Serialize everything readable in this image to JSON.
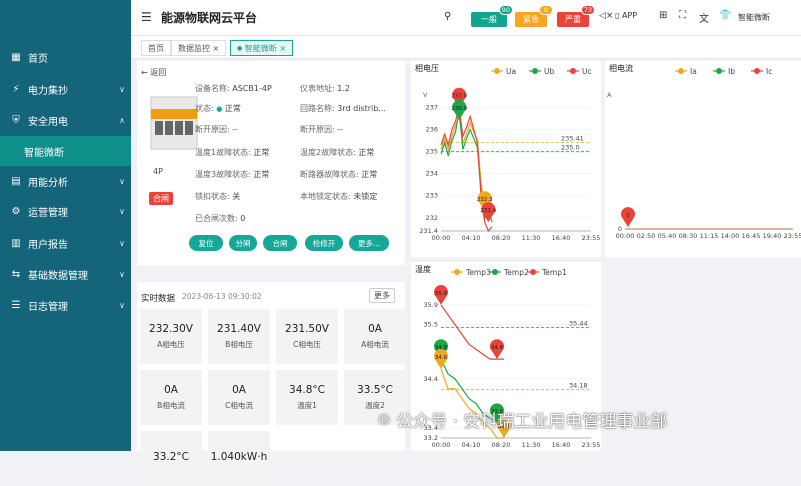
{
  "app": {
    "title": "能源物联网云平台"
  },
  "sidebar": {
    "items": [
      {
        "icon": "▦",
        "label": "首页",
        "chev": ""
      },
      {
        "icon": "⚡",
        "label": "电力集抄",
        "chev": "∨"
      },
      {
        "icon": "⛨",
        "label": "安全用电",
        "chev": "∧"
      },
      {
        "icon": "",
        "label": "智能微断",
        "chev": ""
      },
      {
        "icon": "▤",
        "label": "用能分析",
        "chev": "∨"
      },
      {
        "icon": "⚙",
        "label": "运营管理",
        "chev": "∨"
      },
      {
        "icon": "▥",
        "label": "用户报告",
        "chev": "∨"
      },
      {
        "icon": "⇆",
        "label": "基础数据管理",
        "chev": "∨"
      },
      {
        "icon": "☰",
        "label": "日志管理",
        "chev": "∨"
      }
    ]
  },
  "header": {
    "alarms": [
      {
        "label": "一般",
        "count": "90",
        "color": "#12a58e"
      },
      {
        "label": "紧急",
        "count": "0",
        "color": "#f5a623"
      },
      {
        "label": "严重",
        "count": "73",
        "color": "#e9433a"
      }
    ],
    "app_label": "APP",
    "user": "智能微断",
    "icons": [
      "search-icon",
      "mute-icon",
      "qrcode-icon",
      "fullscreen-icon",
      "language-icon",
      "skin-icon"
    ]
  },
  "tabs": [
    {
      "label": "首页"
    },
    {
      "label": "数据监控",
      "close": "×"
    },
    {
      "label": "智能微断",
      "close": "×"
    }
  ],
  "device": {
    "back": "← 返回",
    "poles": "4P",
    "status_tag": "合闸",
    "fields": [
      {
        "k": "设备名称:",
        "v": "ASCB1-4P"
      },
      {
        "k": "仪表地址:",
        "v": "1.2"
      },
      {
        "k": "状态:",
        "v": "正常"
      },
      {
        "k": "回路名称:",
        "v": "3rd distrib..."
      },
      {
        "k": "断开原因:",
        "v": "--"
      },
      {
        "k": "断开原因:",
        "v": "--"
      },
      {
        "k": "温度1故障状态:",
        "v": "正常"
      },
      {
        "k": "温度2故障状态:",
        "v": "正常"
      },
      {
        "k": "温度3故障状态:",
        "v": "正常"
      },
      {
        "k": "断路器故障状态:",
        "v": "正常"
      },
      {
        "k": "锁扣状态:",
        "v": "关"
      },
      {
        "k": "本地锁定状态:",
        "v": "未锁定"
      },
      {
        "k": "已合闸次数:",
        "v": "0"
      }
    ],
    "buttons": [
      "复位",
      "分闸",
      "合闸",
      "检修开",
      "更多..."
    ]
  },
  "realtime": {
    "title": "实时数据",
    "time": "2023-06-13 09:30:02",
    "more": "更多",
    "tiles": [
      {
        "v": "232.30V",
        "n": "A相电压"
      },
      {
        "v": "231.40V",
        "n": "B相电压"
      },
      {
        "v": "231.50V",
        "n": "C相电压"
      },
      {
        "v": "0A",
        "n": "A相电流"
      },
      {
        "v": "0A",
        "n": "B相电流"
      },
      {
        "v": "0A",
        "n": "C相电流"
      },
      {
        "v": "34.8°C",
        "n": "温度1"
      },
      {
        "v": "33.5°C",
        "n": "温度2"
      },
      {
        "v": "33.2°C",
        "n": ""
      },
      {
        "v": "1.040kW·h",
        "n": ""
      }
    ]
  },
  "watermark": "公众号 · 安科瑞工业用电管理事业部",
  "chart_data": [
    {
      "type": "line",
      "title": "相电压",
      "ylabel": "V",
      "xticks": [
        "00:00",
        "04:10",
        "08:20",
        "11:30",
        "16:40",
        "23:55"
      ],
      "yticks": [
        "231.4",
        "232",
        "233",
        "234",
        "235",
        "236",
        "237"
      ],
      "ylim": [
        231.4,
        237.3
      ],
      "series": [
        {
          "name": "Ua",
          "color": "#f0a81e",
          "max": "237.1",
          "min": "232.3",
          "ref": "235.41",
          "values": [
            [
              0,
              235.1
            ],
            [
              1,
              235.6
            ],
            [
              2,
              235.1
            ],
            [
              3,
              235.7
            ],
            [
              4,
              236.2
            ],
            [
              5,
              236.6
            ],
            [
              6,
              235.4
            ],
            [
              7,
              235.8
            ],
            [
              8,
              236.3
            ],
            [
              9,
              235.9
            ],
            [
              10,
              235.5
            ],
            [
              11,
              233.6
            ],
            [
              12,
              232.3
            ],
            [
              13,
              233.0
            ],
            [
              14,
              232.5
            ]
          ]
        },
        {
          "name": "Ub",
          "color": "#1ba848",
          "max": "236.9",
          "min": "",
          "ref": "235.0",
          "values": [
            [
              0,
              234.9
            ],
            [
              1,
              235.4
            ],
            [
              2,
              234.8
            ],
            [
              3,
              235.5
            ],
            [
              4,
              235.9
            ],
            [
              5,
              236.9
            ],
            [
              6,
              235.1
            ],
            [
              7,
              235.6
            ],
            [
              8,
              236.0
            ],
            [
              9,
              235.6
            ],
            [
              10,
              235.2
            ],
            [
              11,
              233.2
            ],
            [
              12,
              232.0
            ],
            [
              13,
              232.4
            ],
            [
              14,
              231.8
            ]
          ]
        },
        {
          "name": "Uc",
          "color": "#e9433a",
          "max": "237.0",
          "min": "231.4",
          "ref": "",
          "values": [
            [
              0,
              235.3
            ],
            [
              1,
              235.8
            ],
            [
              2,
              235.3
            ],
            [
              3,
              236.0
            ],
            [
              4,
              236.4
            ],
            [
              5,
              237.0
            ],
            [
              6,
              235.7
            ],
            [
              7,
              236.1
            ],
            [
              8,
              236.6
            ],
            [
              9,
              236.0
            ],
            [
              10,
              235.4
            ],
            [
              11,
              233.0
            ],
            [
              12,
              231.8
            ],
            [
              13,
              231.4
            ],
            [
              14,
              231.6
            ]
          ]
        }
      ]
    },
    {
      "type": "line",
      "title": "相电流",
      "ylabel": "A",
      "xticks": [
        "00:00",
        "02:50",
        "05:40",
        "08:30",
        "11:15",
        "14:00",
        "16:45",
        "19:40",
        "23:55"
      ],
      "yticks": [
        "0"
      ],
      "series": [
        {
          "name": "Ia",
          "color": "#f0a81e",
          "values": [
            0,
            0,
            0,
            0,
            0,
            0,
            0,
            0,
            0
          ],
          "max": "0"
        },
        {
          "name": "Ib",
          "color": "#1ba848",
          "values": [
            0,
            0,
            0,
            0,
            0,
            0,
            0,
            0,
            0
          ],
          "max": "0"
        },
        {
          "name": "Ic",
          "color": "#e9433a",
          "values": [
            0,
            0,
            0,
            0,
            0,
            0,
            0,
            0,
            0
          ],
          "max": "0"
        }
      ]
    },
    {
      "type": "line",
      "title": "温度",
      "xticks": [
        "00:00",
        "04:10",
        "08:20",
        "11:30",
        "16:40",
        "23:55"
      ],
      "yticks": [
        "33.2",
        "33.4",
        "34.4",
        "35.5",
        "35.9"
      ],
      "ylim": [
        33.2,
        36.0
      ],
      "series": [
        {
          "name": "Temp3",
          "color": "#f0a81e",
          "max": "34.6",
          "min": "33.2",
          "ref": "34.18",
          "values": [
            [
              0,
              34.6
            ],
            [
              1,
              34.2
            ],
            [
              2,
              34.2
            ],
            [
              3,
              34.0
            ],
            [
              4,
              33.8
            ],
            [
              5,
              33.7
            ],
            [
              6,
              33.5
            ],
            [
              7,
              33.4
            ],
            [
              8,
              33.2
            ],
            [
              9,
              33.2
            ]
          ]
        },
        {
          "name": "Temp2",
          "color": "#1ba848",
          "max": "34.8",
          "min": "33.5",
          "ref": "",
          "values": [
            [
              0,
              34.8
            ],
            [
              1,
              34.5
            ],
            [
              2,
              34.4
            ],
            [
              3,
              34.2
            ],
            [
              4,
              34.0
            ],
            [
              5,
              33.9
            ],
            [
              6,
              33.7
            ],
            [
              7,
              33.6
            ],
            [
              8,
              33.5
            ],
            [
              9,
              33.5
            ]
          ]
        },
        {
          "name": "Temp1",
          "color": "#e9433a",
          "max": "35.9",
          "min": "34.8",
          "ref": "35.44",
          "values": [
            [
              0,
              35.9
            ],
            [
              1,
              35.7
            ],
            [
              2,
              35.5
            ],
            [
              3,
              35.3
            ],
            [
              4,
              35.1
            ],
            [
              5,
              35.0
            ],
            [
              6,
              34.9
            ],
            [
              7,
              34.8
            ],
            [
              8,
              34.8
            ],
            [
              9,
              34.8
            ]
          ]
        }
      ]
    }
  ]
}
